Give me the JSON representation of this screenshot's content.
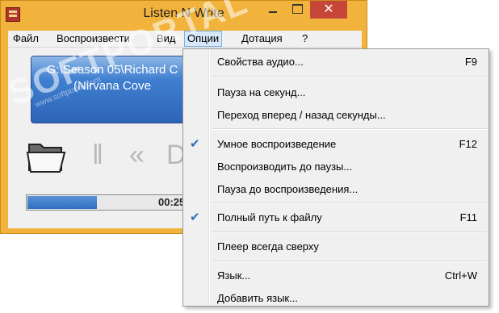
{
  "window": {
    "title": "Listen N Write",
    "close_glyph": "✕"
  },
  "menubar": {
    "items": [
      "Файл",
      "Воспроизвести",
      "Вид",
      "Опции",
      "Дотация",
      "?"
    ]
  },
  "display": {
    "line1": "G:\\Season 05\\Richard C",
    "line2": "(Nirvana Cove"
  },
  "watermark": {
    "text": "SOFTPORTAL",
    "sub": "www.softportal.com"
  },
  "player": {
    "time": "00:25",
    "progress_fraction": 0.44,
    "pause_glyph": "‖",
    "rewind_glyph": "«",
    "stop_glyph": "D"
  },
  "options_menu": {
    "items": [
      {
        "label": "Свойства аудио...",
        "shortcut": "F9",
        "checked": false
      },
      {
        "label": "Пауза на секунд...",
        "shortcut": "",
        "checked": false
      },
      {
        "label": "Переход вперед / назад секунды...",
        "shortcut": "",
        "checked": false
      },
      {
        "label": "Умное воспроизведение",
        "shortcut": "F12",
        "checked": true
      },
      {
        "label": "Воспроизводить до паузы...",
        "shortcut": "",
        "checked": false
      },
      {
        "label": "Пауза до воспроизведения...",
        "shortcut": "",
        "checked": false
      },
      {
        "label": "Полный путь к файлу",
        "shortcut": "F11",
        "checked": true
      },
      {
        "label": "Плеер всегда сверху",
        "shortcut": "",
        "checked": false
      },
      {
        "label": "Язык...",
        "shortcut": "Ctrl+W",
        "checked": false
      },
      {
        "label": "Добавить язык...",
        "shortcut": "",
        "checked": false
      }
    ],
    "check_glyph": "✔"
  }
}
